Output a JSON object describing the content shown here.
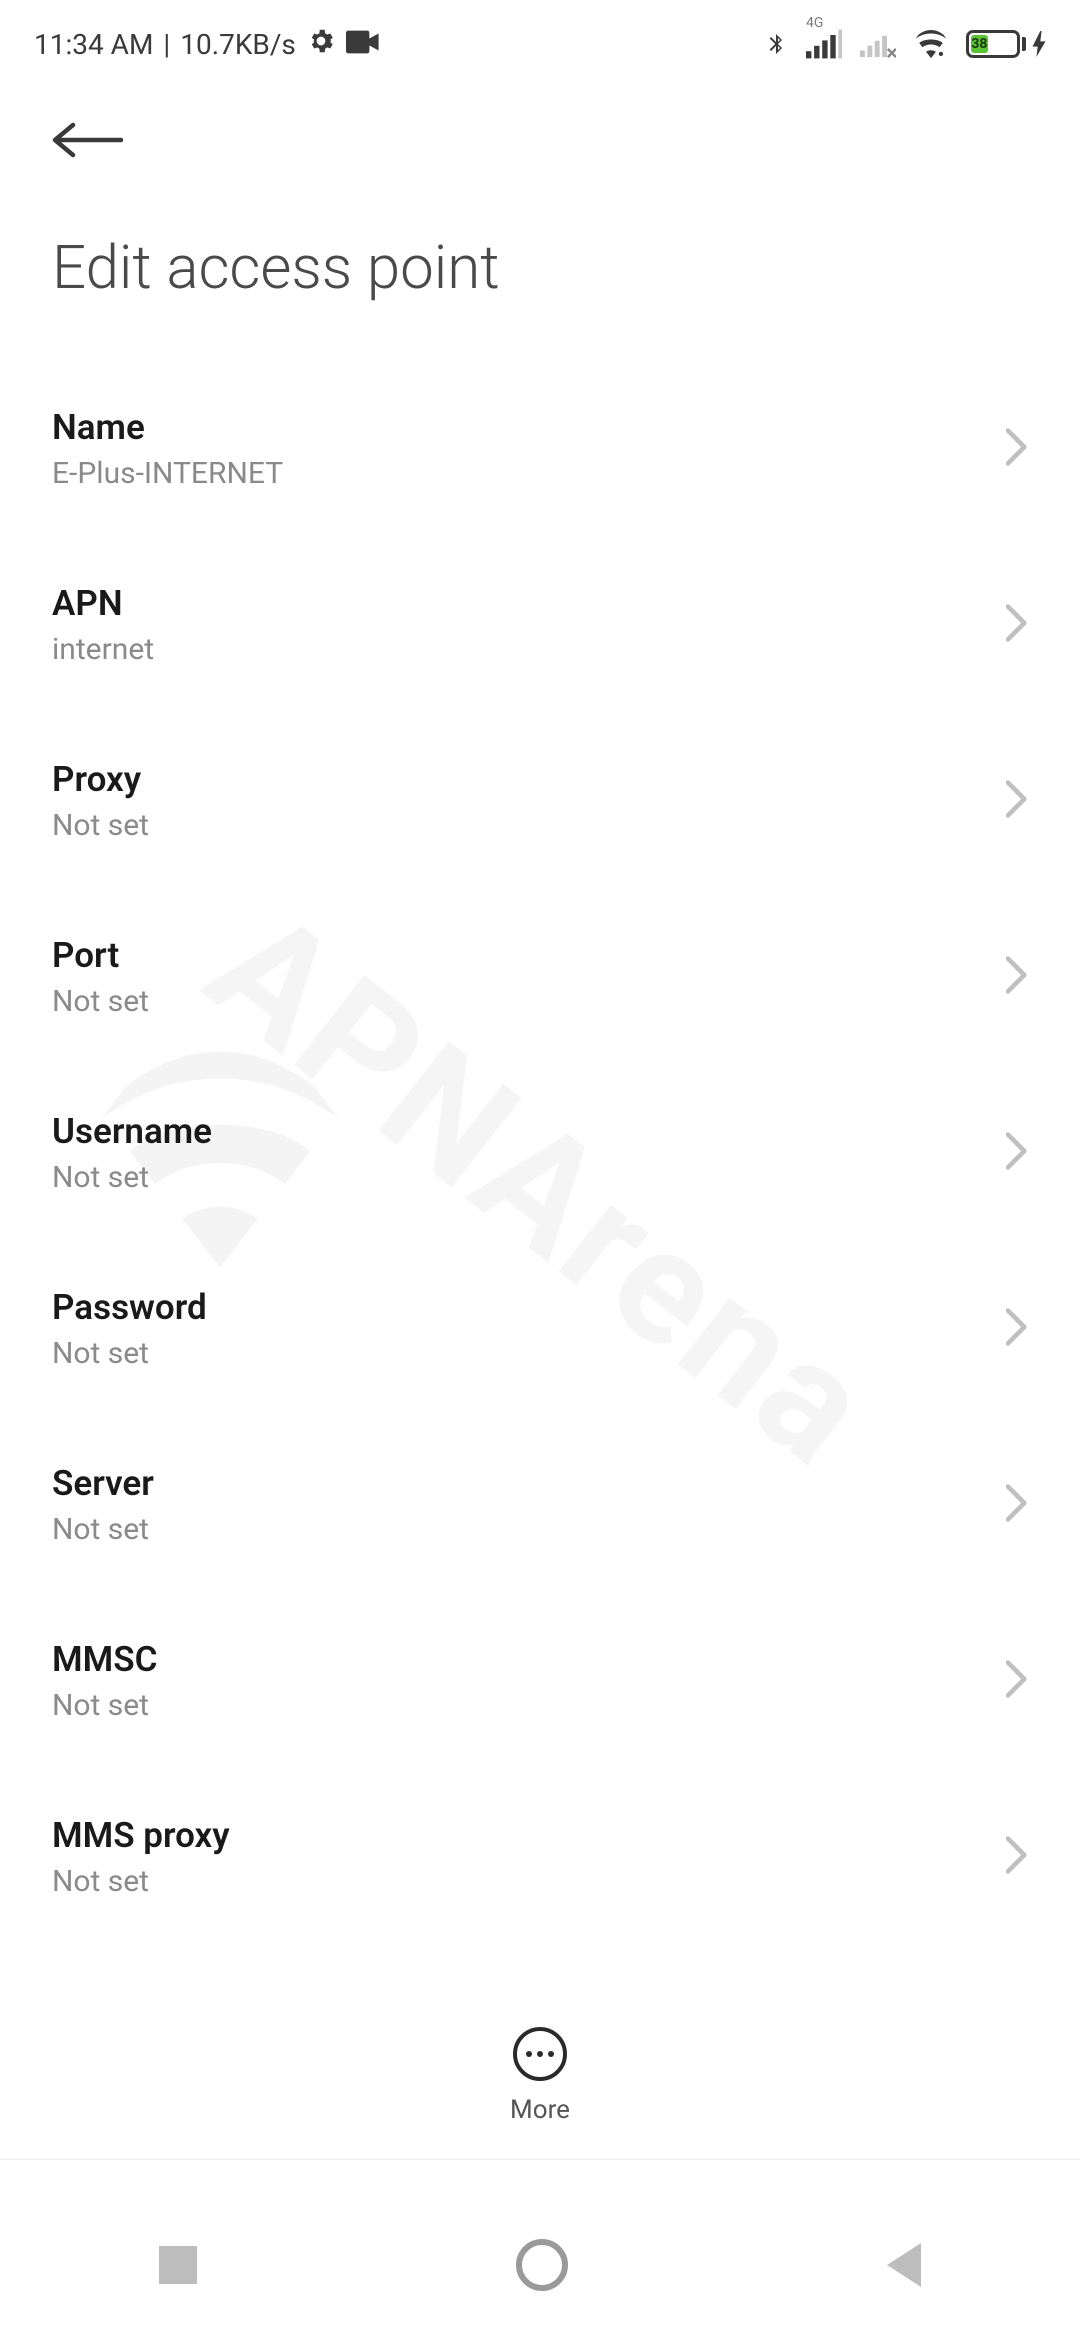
{
  "status": {
    "time": "11:34 AM",
    "net_speed": "10.7KB/s",
    "battery_percent": "38",
    "network_label": "4G"
  },
  "page": {
    "title": "Edit access point"
  },
  "settings": {
    "name": {
      "label": "Name",
      "value": "E-Plus-INTERNET"
    },
    "apn": {
      "label": "APN",
      "value": "internet"
    },
    "proxy": {
      "label": "Proxy",
      "value": "Not set"
    },
    "port": {
      "label": "Port",
      "value": "Not set"
    },
    "username": {
      "label": "Username",
      "value": "Not set"
    },
    "password": {
      "label": "Password",
      "value": "Not set"
    },
    "server": {
      "label": "Server",
      "value": "Not set"
    },
    "mmsc": {
      "label": "MMSC",
      "value": "Not set"
    },
    "mmsproxy": {
      "label": "MMS proxy",
      "value": "Not set"
    }
  },
  "bottom": {
    "more_label": "More"
  },
  "watermark": "APNArena"
}
